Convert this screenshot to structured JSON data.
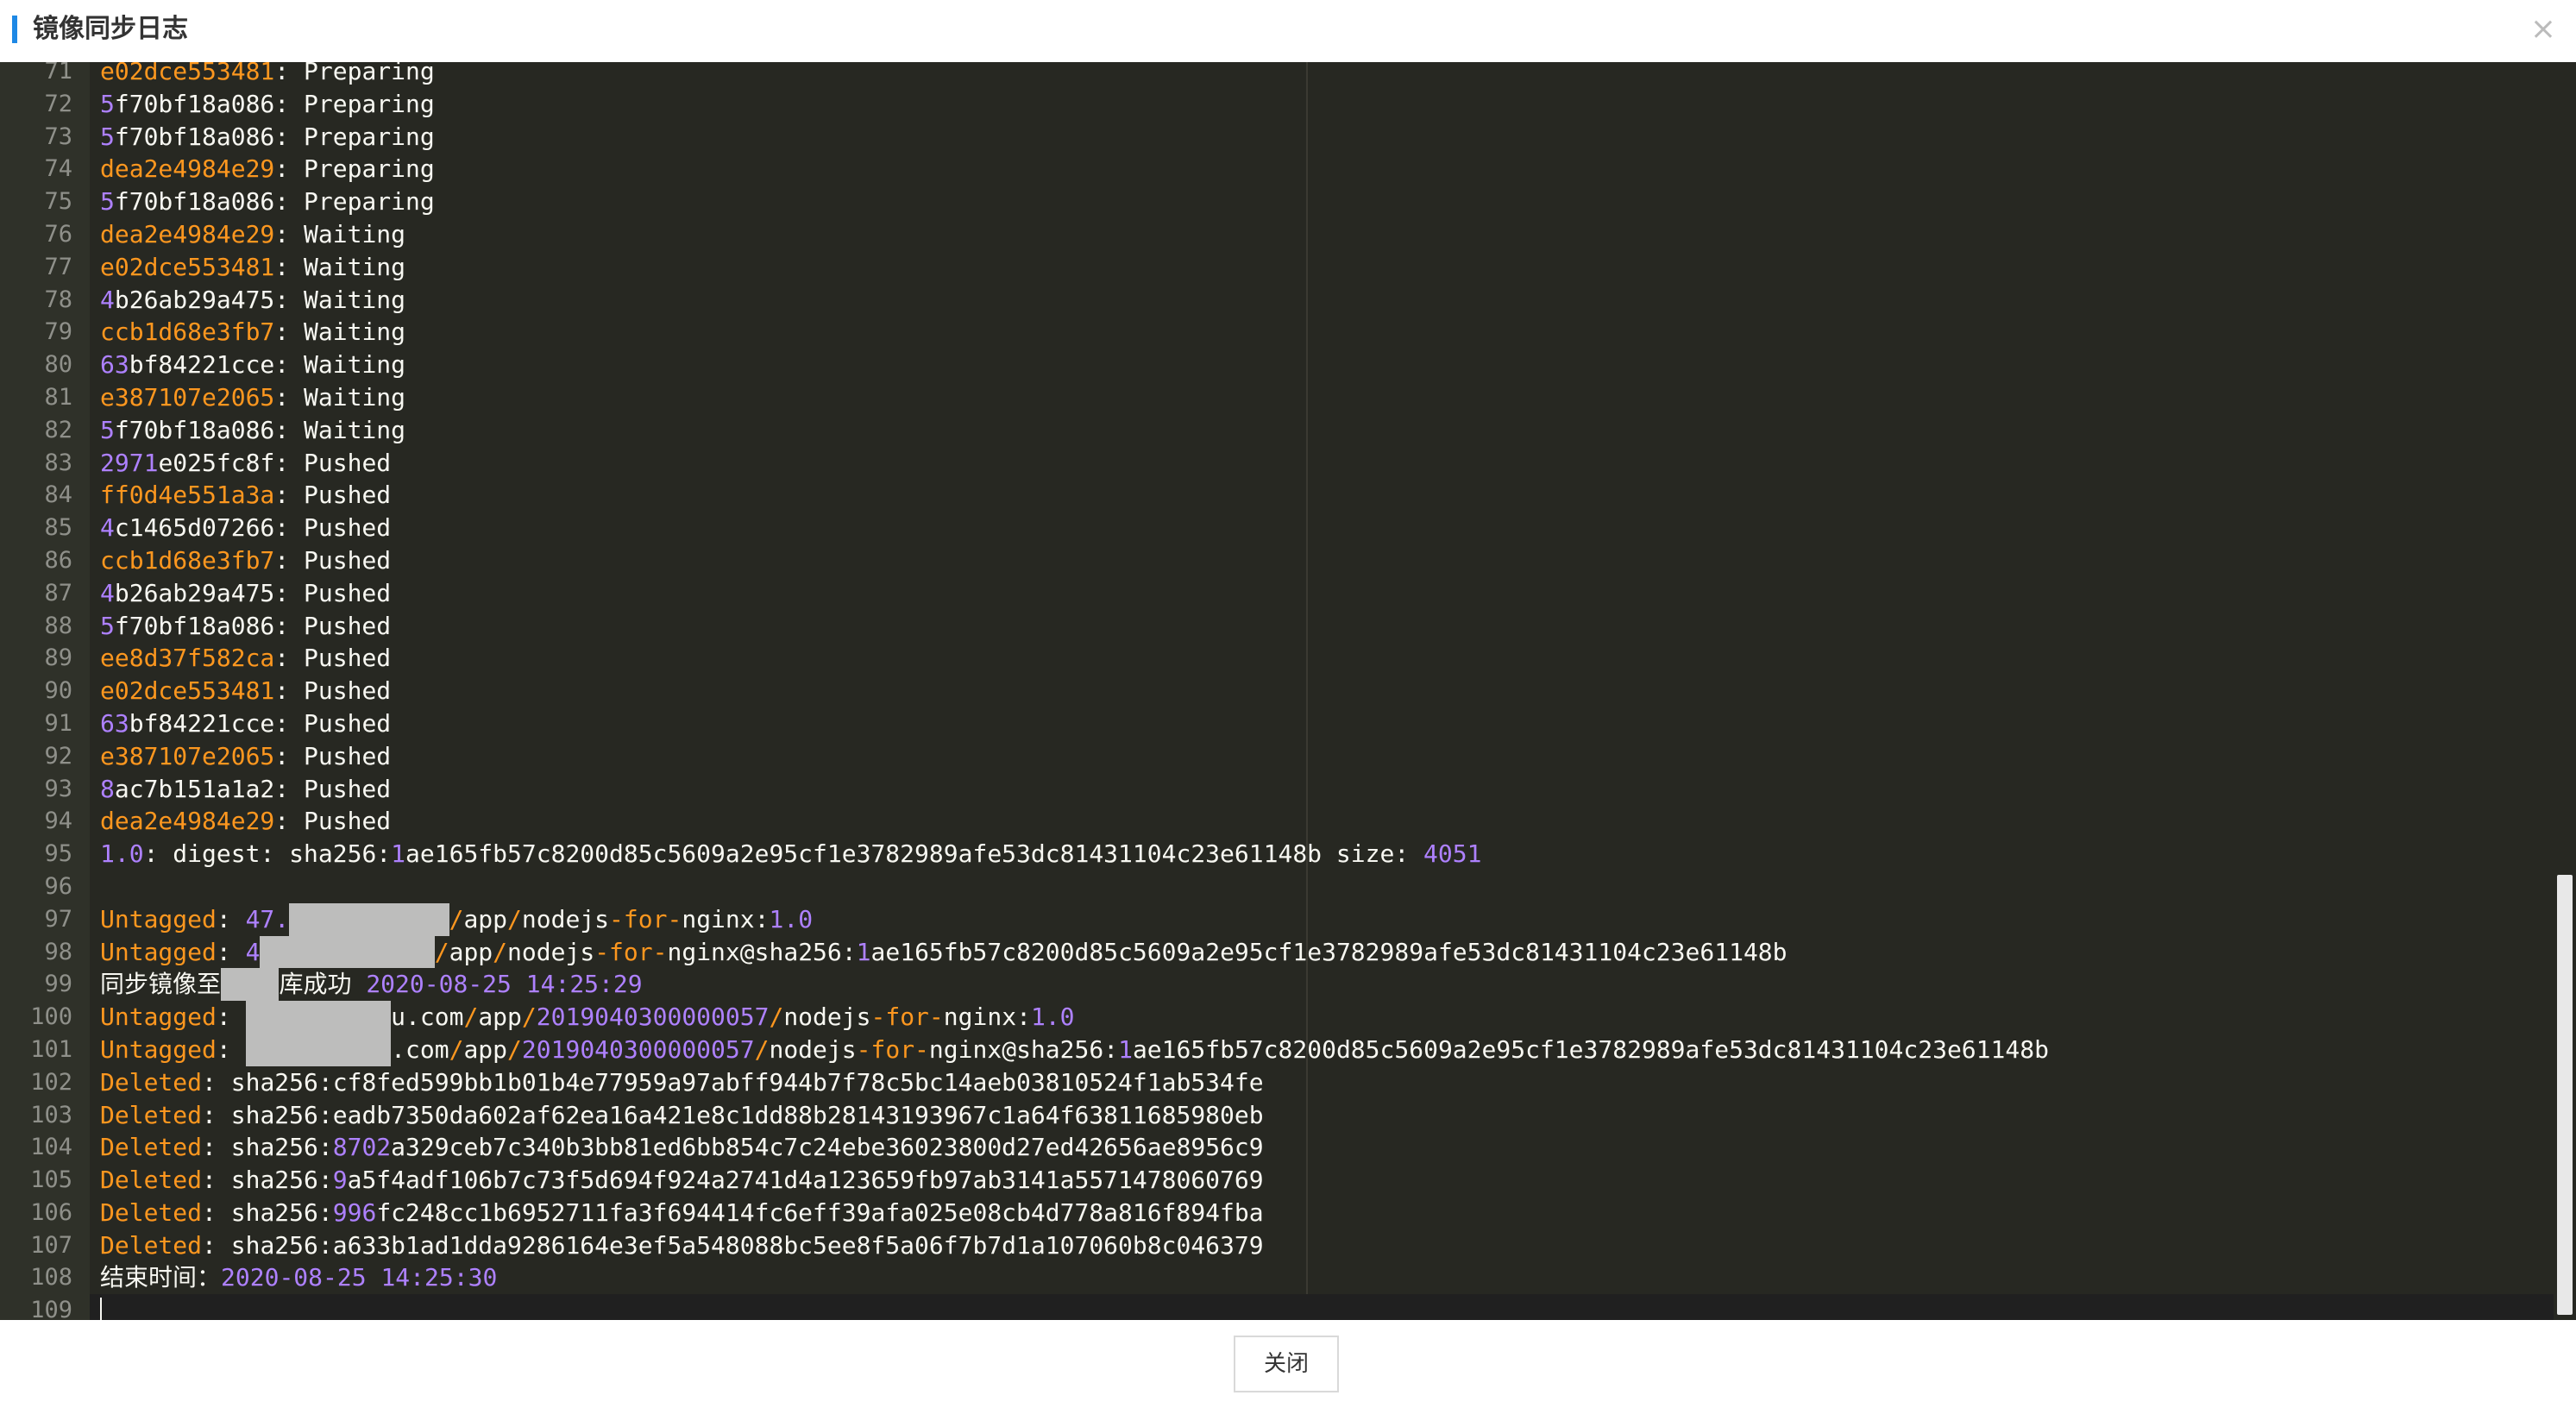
{
  "dialog": {
    "title": "镜像同步日志",
    "close_icon": "×",
    "close_button_label": "关闭"
  },
  "theme": {
    "editor_bg": "#272822",
    "gutter_bg": "#2f3129",
    "accent": "#1e88e5",
    "number_color": "#ae81ff",
    "keyword_color": "#fd971f"
  },
  "log_lines": [
    {
      "n": "71",
      "tokens": [
        {
          "t": "e02dce553481",
          "c": "key"
        },
        {
          "t": ": Preparing",
          "c": "plain"
        }
      ]
    },
    {
      "n": "72",
      "tokens": [
        {
          "t": "5",
          "c": "num"
        },
        {
          "t": "f70bf18a086: Preparing",
          "c": "plain"
        }
      ]
    },
    {
      "n": "73",
      "tokens": [
        {
          "t": "5",
          "c": "num"
        },
        {
          "t": "f70bf18a086: Preparing",
          "c": "plain"
        }
      ]
    },
    {
      "n": "74",
      "tokens": [
        {
          "t": "dea2e4984e29",
          "c": "key"
        },
        {
          "t": ": Preparing",
          "c": "plain"
        }
      ]
    },
    {
      "n": "75",
      "tokens": [
        {
          "t": "5",
          "c": "num"
        },
        {
          "t": "f70bf18a086: Preparing",
          "c": "plain"
        }
      ]
    },
    {
      "n": "76",
      "tokens": [
        {
          "t": "dea2e4984e29",
          "c": "key"
        },
        {
          "t": ": Waiting",
          "c": "plain"
        }
      ]
    },
    {
      "n": "77",
      "tokens": [
        {
          "t": "e02dce553481",
          "c": "key"
        },
        {
          "t": ": Waiting",
          "c": "plain"
        }
      ]
    },
    {
      "n": "78",
      "tokens": [
        {
          "t": "4",
          "c": "num"
        },
        {
          "t": "b26ab29a475: Waiting",
          "c": "plain"
        }
      ]
    },
    {
      "n": "79",
      "tokens": [
        {
          "t": "ccb1d68e3fb7",
          "c": "key"
        },
        {
          "t": ": Waiting",
          "c": "plain"
        }
      ]
    },
    {
      "n": "80",
      "tokens": [
        {
          "t": "63",
          "c": "num"
        },
        {
          "t": "bf84221cce: Waiting",
          "c": "plain"
        }
      ]
    },
    {
      "n": "81",
      "tokens": [
        {
          "t": "e387107e2065",
          "c": "key"
        },
        {
          "t": ": Waiting",
          "c": "plain"
        }
      ]
    },
    {
      "n": "82",
      "tokens": [
        {
          "t": "5",
          "c": "num"
        },
        {
          "t": "f70bf18a086: Waiting",
          "c": "plain"
        }
      ]
    },
    {
      "n": "83",
      "tokens": [
        {
          "t": "2971",
          "c": "num"
        },
        {
          "t": "e025fc8f: Pushed",
          "c": "plain"
        }
      ]
    },
    {
      "n": "84",
      "tokens": [
        {
          "t": "ff0d4e551a3a",
          "c": "key"
        },
        {
          "t": ": Pushed",
          "c": "plain"
        }
      ]
    },
    {
      "n": "85",
      "tokens": [
        {
          "t": "4",
          "c": "num"
        },
        {
          "t": "c1465d07266: Pushed",
          "c": "plain"
        }
      ]
    },
    {
      "n": "86",
      "tokens": [
        {
          "t": "ccb1d68e3fb7",
          "c": "key"
        },
        {
          "t": ": Pushed",
          "c": "plain"
        }
      ]
    },
    {
      "n": "87",
      "tokens": [
        {
          "t": "4",
          "c": "num"
        },
        {
          "t": "b26ab29a475: Pushed",
          "c": "plain"
        }
      ]
    },
    {
      "n": "88",
      "tokens": [
        {
          "t": "5",
          "c": "num"
        },
        {
          "t": "f70bf18a086: Pushed",
          "c": "plain"
        }
      ]
    },
    {
      "n": "89",
      "tokens": [
        {
          "t": "ee8d37f582ca",
          "c": "key"
        },
        {
          "t": ": Pushed",
          "c": "plain"
        }
      ]
    },
    {
      "n": "90",
      "tokens": [
        {
          "t": "e02dce553481",
          "c": "key"
        },
        {
          "t": ": Pushed",
          "c": "plain"
        }
      ]
    },
    {
      "n": "91",
      "tokens": [
        {
          "t": "63",
          "c": "num"
        },
        {
          "t": "bf84221cce: Pushed",
          "c": "plain"
        }
      ]
    },
    {
      "n": "92",
      "tokens": [
        {
          "t": "e387107e2065",
          "c": "key"
        },
        {
          "t": ": Pushed",
          "c": "plain"
        }
      ]
    },
    {
      "n": "93",
      "tokens": [
        {
          "t": "8",
          "c": "num"
        },
        {
          "t": "ac7b151a1a2: Pushed",
          "c": "plain"
        }
      ]
    },
    {
      "n": "94",
      "tokens": [
        {
          "t": "dea2e4984e29",
          "c": "key"
        },
        {
          "t": ": Pushed",
          "c": "plain"
        }
      ]
    },
    {
      "n": "95",
      "tokens": [
        {
          "t": "1.0",
          "c": "num"
        },
        {
          "t": ": digest: sha256:",
          "c": "plain"
        },
        {
          "t": "1",
          "c": "num"
        },
        {
          "t": "ae165fb57c8200d85c5609a2e95cf1e3782989afe53dc81431104c23e61148b size: ",
          "c": "plain"
        },
        {
          "t": "4051",
          "c": "num"
        }
      ]
    },
    {
      "n": "96",
      "tokens": []
    },
    {
      "n": "97",
      "tokens": [
        {
          "t": "Untagged",
          "c": "key"
        },
        {
          "t": ": ",
          "c": "plain"
        },
        {
          "t": "47.",
          "c": "num"
        },
        {
          "t": "███.███.███",
          "c": "redact"
        },
        {
          "t": "/",
          "c": "key"
        },
        {
          "t": "app",
          "c": "plain"
        },
        {
          "t": "/",
          "c": "key"
        },
        {
          "t": "nodejs",
          "c": "plain"
        },
        {
          "t": "-for-",
          "c": "key"
        },
        {
          "t": "nginx:",
          "c": "plain"
        },
        {
          "t": "1.0",
          "c": "num"
        }
      ]
    },
    {
      "n": "98",
      "tokens": [
        {
          "t": "Untagged",
          "c": "key"
        },
        {
          "t": ": ",
          "c": "plain"
        },
        {
          "t": "4",
          "c": "num"
        },
        {
          "t": "████.███.███",
          "c": "redact"
        },
        {
          "t": "/",
          "c": "key"
        },
        {
          "t": "app",
          "c": "plain"
        },
        {
          "t": "/",
          "c": "key"
        },
        {
          "t": "nodejs",
          "c": "plain"
        },
        {
          "t": "-for-",
          "c": "key"
        },
        {
          "t": "nginx@sha256:",
          "c": "plain"
        },
        {
          "t": "1",
          "c": "num"
        },
        {
          "t": "ae165fb57c8200d85c5609a2e95cf1e3782989afe53dc81431104c23e61148b",
          "c": "plain"
        }
      ]
    },
    {
      "n": "99",
      "tokens": [
        {
          "t": "同步镜像至",
          "c": "plain"
        },
        {
          "t": "████",
          "c": "redact"
        },
        {
          "t": "库成功 ",
          "c": "plain"
        },
        {
          "t": "2020-08-25 14:25:29",
          "c": "num"
        }
      ]
    },
    {
      "n": "100",
      "tokens": [
        {
          "t": "Untagged",
          "c": "key"
        },
        {
          "t": ": ",
          "c": "plain"
        },
        {
          "t": "██████████",
          "c": "redact"
        },
        {
          "t": "u.com",
          "c": "plain"
        },
        {
          "t": "/",
          "c": "key"
        },
        {
          "t": "app",
          "c": "plain"
        },
        {
          "t": "/",
          "c": "key"
        },
        {
          "t": "2019040300000057",
          "c": "num"
        },
        {
          "t": "/",
          "c": "key"
        },
        {
          "t": "nodejs",
          "c": "plain"
        },
        {
          "t": "-for-",
          "c": "key"
        },
        {
          "t": "nginx:",
          "c": "plain"
        },
        {
          "t": "1.0",
          "c": "num"
        }
      ]
    },
    {
      "n": "101",
      "tokens": [
        {
          "t": "Untagged",
          "c": "key"
        },
        {
          "t": ": ",
          "c": "plain"
        },
        {
          "t": "██████████",
          "c": "redact"
        },
        {
          "t": ".com",
          "c": "plain"
        },
        {
          "t": "/",
          "c": "key"
        },
        {
          "t": "app",
          "c": "plain"
        },
        {
          "t": "/",
          "c": "key"
        },
        {
          "t": "2019040300000057",
          "c": "num"
        },
        {
          "t": "/",
          "c": "key"
        },
        {
          "t": "nodejs",
          "c": "plain"
        },
        {
          "t": "-for-",
          "c": "key"
        },
        {
          "t": "nginx@sha256:",
          "c": "plain"
        },
        {
          "t": "1",
          "c": "num"
        },
        {
          "t": "ae165fb57c8200d85c5609a2e95cf1e3782989afe53dc81431104c23e61148b",
          "c": "plain"
        }
      ]
    },
    {
      "n": "102",
      "tokens": [
        {
          "t": "Deleted",
          "c": "key"
        },
        {
          "t": ": sha256:cf8fed599bb1b01b4e77959a97abff944b7f78c5bc14aeb03810524f1ab534fe",
          "c": "plain"
        }
      ]
    },
    {
      "n": "103",
      "tokens": [
        {
          "t": "Deleted",
          "c": "key"
        },
        {
          "t": ": sha256:eadb7350da602af62ea16a421e8c1dd88b28143193967c1a64f63811685980eb",
          "c": "plain"
        }
      ]
    },
    {
      "n": "104",
      "tokens": [
        {
          "t": "Deleted",
          "c": "key"
        },
        {
          "t": ": sha256:",
          "c": "plain"
        },
        {
          "t": "8702",
          "c": "num"
        },
        {
          "t": "a329ceb7c340b3bb81ed6bb854c7c24ebe36023800d27ed42656ae8956c9",
          "c": "plain"
        }
      ]
    },
    {
      "n": "105",
      "tokens": [
        {
          "t": "Deleted",
          "c": "key"
        },
        {
          "t": ": sha256:",
          "c": "plain"
        },
        {
          "t": "9",
          "c": "num"
        },
        {
          "t": "a5f4adf106b7c73f5d694f924a2741d4a123659fb97ab3141a5571478060769",
          "c": "plain"
        }
      ]
    },
    {
      "n": "106",
      "tokens": [
        {
          "t": "Deleted",
          "c": "key"
        },
        {
          "t": ": sha256:",
          "c": "plain"
        },
        {
          "t": "996",
          "c": "num"
        },
        {
          "t": "fc248cc1b6952711fa3f694414fc6eff39afa025e08cb4d778a816f894fba",
          "c": "plain"
        }
      ]
    },
    {
      "n": "107",
      "tokens": [
        {
          "t": "Deleted",
          "c": "key"
        },
        {
          "t": ": sha256:a633b1ad1dda9286164e3ef5a548088bc5ee8f5a06f7b7d1a107060b8c046379",
          "c": "plain"
        }
      ]
    },
    {
      "n": "108",
      "tokens": [
        {
          "t": "结束时间：",
          "c": "plain"
        },
        {
          "t": "2020-08-25 14:25:30",
          "c": "num"
        }
      ]
    },
    {
      "n": "109",
      "tokens": [],
      "cursor": true
    }
  ]
}
